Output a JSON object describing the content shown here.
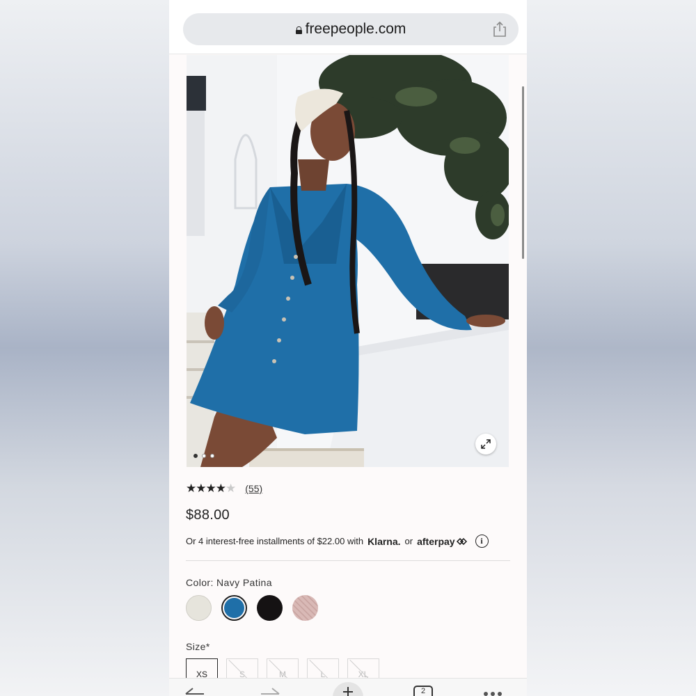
{
  "browser": {
    "url": "freepeople.com",
    "tab_count": "2"
  },
  "product": {
    "rating_stars": 4,
    "rating_max": 5,
    "review_count": "(55)",
    "price": "$88.00",
    "installments": {
      "text": "Or 4 interest-free installments of $22.00 with",
      "klarna": "Klarna.",
      "or": "or",
      "afterpay": "afterpay",
      "info_glyph": "i"
    },
    "color_label": "Color: Navy Patina",
    "swatches": [
      {
        "name": "cream",
        "color": "#e6e4dc",
        "selected": false
      },
      {
        "name": "navy patina",
        "color": "#1f6fa8",
        "selected": true
      },
      {
        "name": "black",
        "color": "#151213",
        "selected": false
      },
      {
        "name": "pink",
        "color": "#d9b9b6",
        "selected": false
      }
    ],
    "size_label": "Size*",
    "sizes": [
      {
        "label": "XS",
        "available": true,
        "selected": true
      },
      {
        "label": "S",
        "available": false,
        "selected": false
      },
      {
        "label": "M",
        "available": false,
        "selected": false
      },
      {
        "label": "L",
        "available": false,
        "selected": false
      },
      {
        "label": "XL",
        "available": false,
        "selected": false
      }
    ],
    "image_dots": 3,
    "active_dot": 0
  },
  "colors": {
    "dress_blue": "#1f6fa8",
    "accent_dark": "#1e1e1e"
  }
}
